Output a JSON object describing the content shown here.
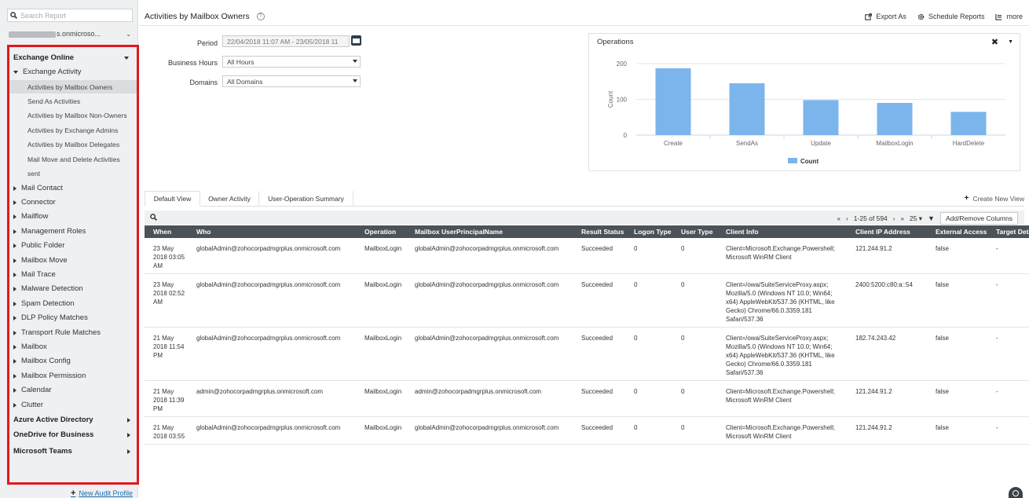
{
  "sidebar": {
    "search_placeholder": "Search Report",
    "tenant_suffix": "s.onmicroso...",
    "tree": [
      {
        "label": "Exchange Online",
        "level": 0,
        "expanded": true
      },
      {
        "label": "Exchange Activity",
        "level": 1,
        "expanded": true
      },
      {
        "label": "Activities by Mailbox Owners",
        "level": 2,
        "selected": true
      },
      {
        "label": "Send As Activities",
        "level": 2
      },
      {
        "label": "Activities by Mailbox Non-Owners",
        "level": 2
      },
      {
        "label": "Activities by Exchange Admins",
        "level": 2
      },
      {
        "label": "Activities by Mailbox Delegates",
        "level": 2
      },
      {
        "label": "Mail Move and Delete Activities",
        "level": 2
      },
      {
        "label": "sent",
        "level": 2
      },
      {
        "label": "Mail Contact",
        "level": 1
      },
      {
        "label": "Connector",
        "level": 1
      },
      {
        "label": "Mailflow",
        "level": 1
      },
      {
        "label": "Management Roles",
        "level": 1
      },
      {
        "label": "Public Folder",
        "level": 1
      },
      {
        "label": "Mailbox Move",
        "level": 1
      },
      {
        "label": "Mail Trace",
        "level": 1
      },
      {
        "label": "Malware Detection",
        "level": 1
      },
      {
        "label": "Spam Detection",
        "level": 1
      },
      {
        "label": "DLP Policy Matches",
        "level": 1
      },
      {
        "label": "Transport Rule Matches",
        "level": 1
      },
      {
        "label": "Mailbox",
        "level": 1
      },
      {
        "label": "Mailbox Config",
        "level": 1
      },
      {
        "label": "Mailbox Permission",
        "level": 1
      },
      {
        "label": "Calendar",
        "level": 1
      },
      {
        "label": "Clutter",
        "level": 1
      },
      {
        "label": "Azure Active Directory",
        "level": 0
      },
      {
        "label": "OneDrive for Business",
        "level": 0
      },
      {
        "label": "Microsoft Teams",
        "level": 0
      }
    ],
    "new_profile": "New Audit Profile"
  },
  "header": {
    "title": "Activities by Mailbox Owners",
    "actions": [
      "Export As",
      "Schedule Reports",
      "more"
    ]
  },
  "filters": {
    "period_label": "Period",
    "period_value": "22/04/2018 11:07 AM - 23/05/2018 11",
    "hours_label": "Business Hours",
    "hours_value": "All Hours",
    "domains_label": "Domains",
    "domains_value": "All Domains"
  },
  "chart_data": {
    "type": "bar",
    "title": "Operations",
    "categories": [
      "Create",
      "SendAs",
      "Update",
      "MailboxLogin",
      "HardDelete"
    ],
    "values": [
      187,
      145,
      98,
      90,
      65
    ],
    "ylabel": "Count",
    "ylim": [
      0,
      200
    ],
    "yticks": [
      "0",
      "100",
      "200"
    ],
    "legend": "Count",
    "legend_position": "bottom",
    "color": "#7cb5ec",
    "grid": true
  },
  "tabs": [
    "Default View",
    "Owner Activity",
    "User-Operation Summary"
  ],
  "new_view": "Create New View",
  "pager": {
    "range": "1-25 of 594",
    "page_size": "25",
    "columns_button": "Add/Remove Columns"
  },
  "table": {
    "headers": [
      "When",
      "Who",
      "Operation",
      "Mailbox UserPrincipalName",
      "Result Status",
      "Logon Type",
      "User Type",
      "Client Info",
      "Client IP Address",
      "External Access",
      "Target Deta"
    ],
    "rows": [
      [
        "23 May 2018 03:05 AM",
        "globalAdmin@zohocorpadmgrplus.onmicrosoft.com",
        "MailboxLogin",
        "globalAdmin@zohocorpadmgrplus.onmicrosoft.com",
        "Succeeded",
        "0",
        "0",
        "Client=Microsoft.Exchange.Powershell; Microsoft WinRM Client",
        "121.244.91.2",
        "false",
        "-"
      ],
      [
        "23 May 2018 02:52 AM",
        "globalAdmin@zohocorpadmgrplus.onmicrosoft.com",
        "MailboxLogin",
        "globalAdmin@zohocorpadmgrplus.onmicrosoft.com",
        "Succeeded",
        "0",
        "0",
        "Client=/owa/SuiteServiceProxy.aspx; Mozilla/5.0 (Windows NT 10.0; Win64; x64) AppleWebKit/537.36 (KHTML, like Gecko) Chrome/66.0.3359.181 Safari/537.36",
        "2400:5200:c80:a::54",
        "false",
        "-"
      ],
      [
        "21 May 2018 11:54 PM",
        "globalAdmin@zohocorpadmgrplus.onmicrosoft.com",
        "MailboxLogin",
        "globalAdmin@zohocorpadmgrplus.onmicrosoft.com",
        "Succeeded",
        "0",
        "0",
        "Client=/owa/SuiteServiceProxy.aspx; Mozilla/5.0 (Windows NT 10.0; Win64; x64) AppleWebKit/537.36 (KHTML, like Gecko) Chrome/66.0.3359.181 Safari/537.36",
        "182.74.243.42",
        "false",
        "-"
      ],
      [
        "21 May 2018 11:39 PM",
        "admin@zohocorpadmgrplus.onmicrosoft.com",
        "MailboxLogin",
        "admin@zohocorpadmgrplus.onmicrosoft.com",
        "Succeeded",
        "0",
        "0",
        "Client=Microsoft.Exchange.Powershell; Microsoft WinRM Client",
        "121.244.91.2",
        "false",
        "-"
      ],
      [
        "21 May 2018 03:55",
        "globalAdmin@zohocorpadmgrplus.onmicrosoft.com",
        "MailboxLogin",
        "globalAdmin@zohocorpadmgrplus.onmicrosoft.com",
        "Succeeded",
        "0",
        "0",
        "Client=Microsoft.Exchange.Powershell; Microsoft WinRM Client",
        "121.244.91.2",
        "false",
        "-"
      ]
    ]
  }
}
